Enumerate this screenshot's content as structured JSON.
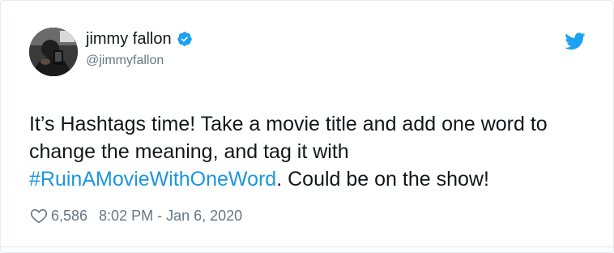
{
  "author": {
    "display_name": "jimmy fallon",
    "handle": "@jimmyfallon",
    "verified": true,
    "verified_icon": "verified-badge-icon",
    "avatar_icon": "profile-photo"
  },
  "brand": {
    "icon": "twitter-bird-icon",
    "color": "#1da1f2"
  },
  "tweet": {
    "text_part1": "It’s Hashtags time! Take a movie title and add one word to change the meaning, and tag it with ",
    "hashtag": "#RuinAMovieWithOneWord",
    "text_part2": ". Could be on the show!"
  },
  "meta": {
    "likes_icon": "heart-icon",
    "likes": "6,586",
    "timestamp": "8:02 PM - Jan 6, 2020"
  },
  "colors": {
    "link": "#1b95e0",
    "secondary_text": "#657786",
    "primary_text": "#14171a"
  }
}
